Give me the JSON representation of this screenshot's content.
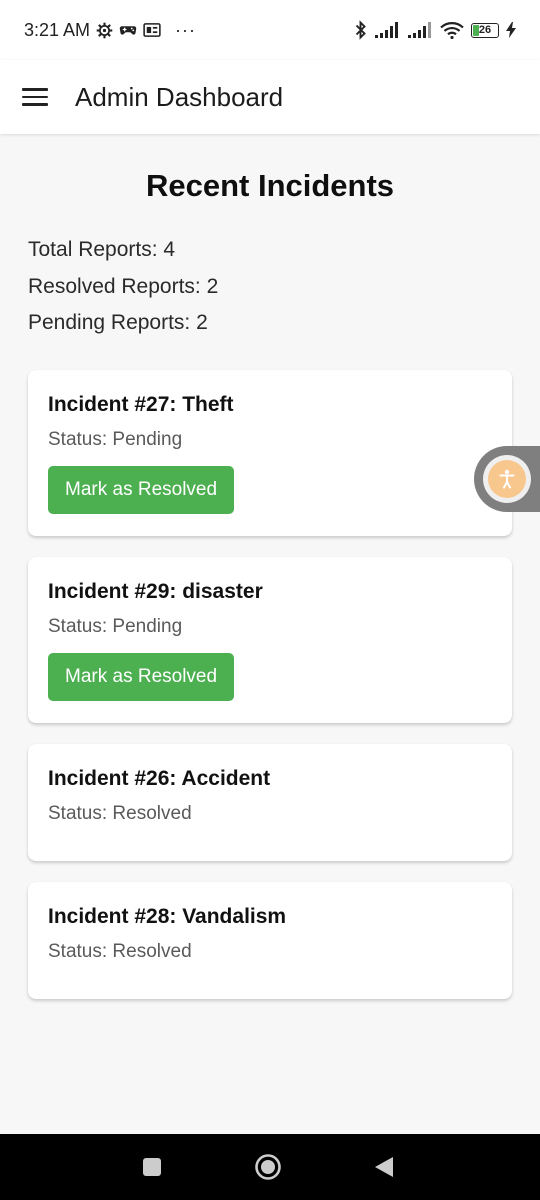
{
  "status_bar": {
    "time": "3:21 AM",
    "battery_level": "26",
    "icons": [
      "settings-gear-icon",
      "gamepad-icon",
      "sim-card-icon",
      "more-dots-icon",
      "bluetooth-icon",
      "signal-icon",
      "signal-icon",
      "wifi-icon",
      "battery-icon",
      "charging-bolt-icon"
    ],
    "more": "···"
  },
  "app_bar": {
    "title": "Admin Dashboard",
    "menu_icon": "hamburger-menu-icon"
  },
  "page": {
    "title": "Recent Incidents"
  },
  "stats": {
    "total": "Total Reports: 4",
    "resolved": "Resolved Reports: 2",
    "pending": "Pending Reports: 2"
  },
  "incidents": [
    {
      "title": "Incident #27: Theft",
      "status": "Status: Pending",
      "action": "Mark as Resolved"
    },
    {
      "title": "Incident #29: disaster",
      "status": "Status: Pending",
      "action": "Mark as Resolved"
    },
    {
      "title": "Incident #26: Accident",
      "status": "Status: Resolved"
    },
    {
      "title": "Incident #28: Vandalism",
      "status": "Status: Resolved"
    }
  ],
  "floating_button": {
    "icon": "accessibility-icon"
  },
  "nav_bar": {
    "icons": [
      "recents-square-icon",
      "home-circle-icon",
      "back-triangle-icon"
    ]
  },
  "colors": {
    "accent_green": "#4caf50",
    "background": "#f7f7f7",
    "card": "#ffffff",
    "fab": "#f8c78d"
  }
}
